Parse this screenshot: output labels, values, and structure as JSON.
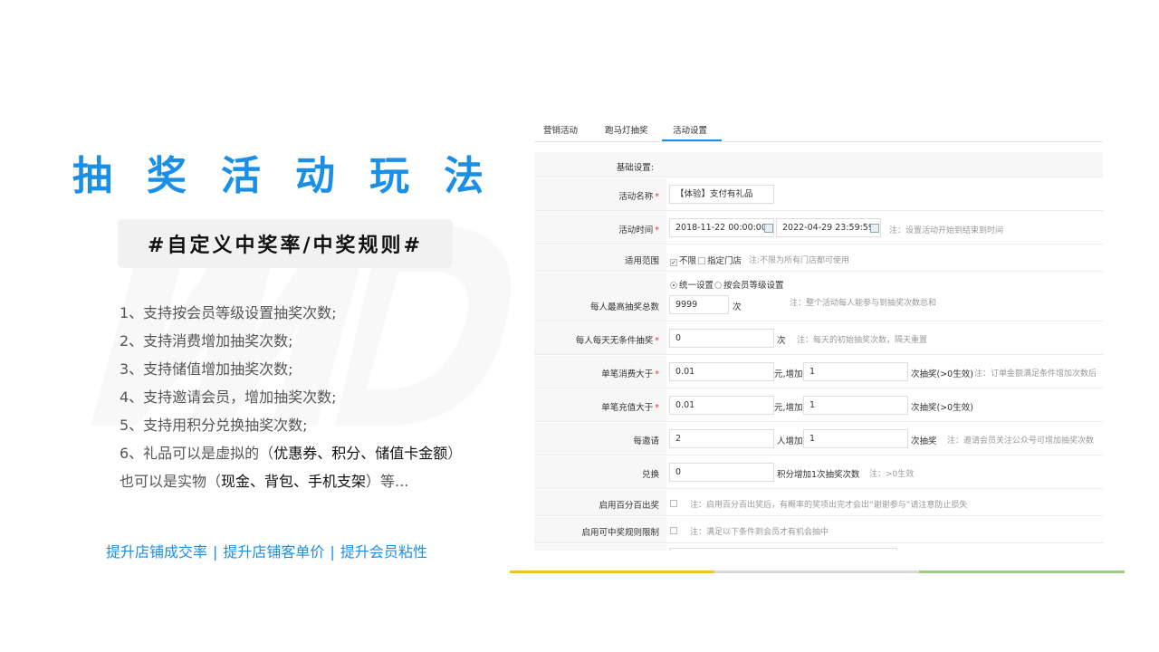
{
  "headline": "抽奖活动玩法",
  "badge": "#自定义中奖率/中奖规则#",
  "features": [
    {
      "text": "1、支持按会员等级设置抽奖次数;"
    },
    {
      "text": "2、支持消费增加抽奖次数;"
    },
    {
      "text": "3、支持储值增加抽奖次数;"
    },
    {
      "text": "4、支持邀请会员，增加抽奖次数;"
    },
    {
      "text": "5、支持用积分兑换抽奖次数;"
    },
    {
      "pre": "6、礼品可以是虚拟的（",
      "em": "优惠券、积分、储值卡金额",
      "post": "）"
    },
    {
      "pre": "也可以是实物（",
      "em": "现金、背包、手机支架",
      "post": "）等..."
    }
  ],
  "benefits": [
    "提升店铺成交率",
    "提升店铺客单价",
    "提升会员粘性"
  ],
  "colors": {
    "accent": "#1a8fe8",
    "bar_yellow": "#f5c02a",
    "bar_gray": "#d9d9d9",
    "bar_green": "#9ccf7a"
  },
  "panel": {
    "tabs": [
      "营销活动",
      "跑马灯抽奖",
      "活动设置"
    ],
    "active_tab": "活动设置",
    "section_label": "基础设置:",
    "activity_name": {
      "label": "活动名称",
      "value": "【体验】支付有礼品"
    },
    "activity_time": {
      "label": "活动时间",
      "start": "2018-11-22 00:00:00",
      "end": "2022-04-29 23:59:59",
      "note": "注：设置活动开始到结束到时间"
    },
    "scope": {
      "label": "适用范围",
      "option1": "不限",
      "option2": "指定门店",
      "note": "注:不限为所有门店都可使用"
    },
    "max_draws": {
      "label": "每人最高抽奖总数",
      "radio1": "统一设置",
      "radio2": "按会员等级设置",
      "value": "9999",
      "unit": "次",
      "note": "注：整个活动每人能参与到抽奖次数总和"
    },
    "daily_free": {
      "label": "每人每天无条件抽奖",
      "value": "0",
      "unit": "次",
      "note": "注：每天的初始抽奖次数，隔天重置"
    },
    "single_spend": {
      "label": "单笔消费大于",
      "value": "0.01",
      "mid": "元,增加",
      "value2": "1",
      "unit": "次抽奖(>0生效)",
      "note": "注：订单金额满足条件增加次数后"
    },
    "single_recharge": {
      "label": "单笔充值大于",
      "value": "0.01",
      "mid": "元,增加",
      "value2": "1",
      "unit": "次抽奖(>0生效)"
    },
    "invite": {
      "label": "每邀请",
      "value": "2",
      "mid": "人增加",
      "value2": "1",
      "unit": "次抽奖",
      "note": "注：邀请会员关注公众号可增加抽奖次数"
    },
    "exchange": {
      "label": "兑换",
      "value": "0",
      "unit": "积分增加1次抽奖次数",
      "note": "注：>0生效"
    },
    "hundred": {
      "label": "启用百分百出奖",
      "note": "注：启用百分百出奖后，有概率的奖项出完才会出“谢谢参与”请注意防止损失"
    },
    "rule_limit": {
      "label": "启用可中奖规则限制",
      "note": "注：满足以下条件到会员才有机会抽中"
    }
  }
}
